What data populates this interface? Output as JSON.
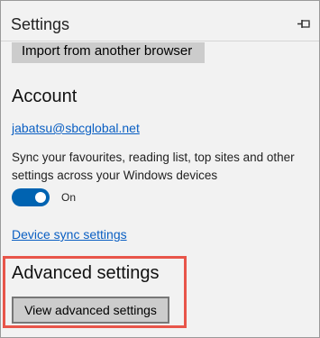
{
  "panel": {
    "title": "Settings",
    "pin_icon": "pin-icon"
  },
  "import": {
    "label": "Import from another browser"
  },
  "account": {
    "heading": "Account",
    "email": "jabatsu@sbcglobal.net",
    "sync_description": "Sync your favourites, reading list, top sites and other settings across your Windows devices",
    "sync_toggle": {
      "state": "On",
      "on": true,
      "color": "#0063b1"
    },
    "device_sync_link": "Device sync settings"
  },
  "advanced": {
    "heading": "Advanced settings",
    "button_label": "View advanced settings",
    "highlight_color": "#e8554a"
  }
}
